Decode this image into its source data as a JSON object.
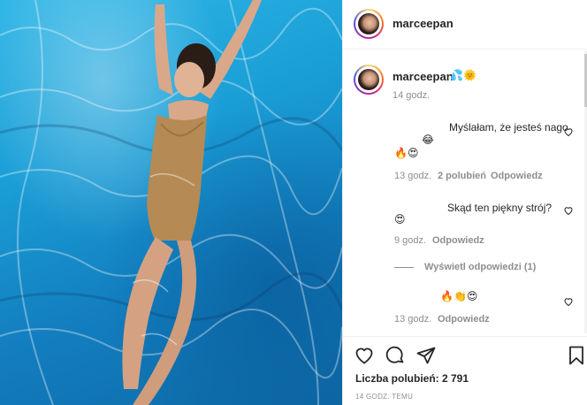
{
  "header": {
    "username": "marceepan"
  },
  "caption": {
    "username": "marceepan",
    "emojis": "💦🌞",
    "time": "14 godz."
  },
  "comments": [
    {
      "text": "Myślałam, że jesteś nago",
      "emoji_inline": "😂",
      "emoji_line": "🔥😍",
      "time": "13 godz.",
      "likes": "2 polubień",
      "reply": "Odpowiedz"
    },
    {
      "text": "Skąd ten piękny strój?",
      "emoji_line": "😍",
      "time": "9 godz.",
      "reply": "Odpowiedz",
      "view_replies": "Wyświetl odpowiedzi (1)"
    },
    {
      "emoji_line": "🔥👏😍",
      "time": "13 godz.",
      "reply": "Odpowiedz"
    }
  ],
  "actions": {
    "like_icon": "heart-icon",
    "comment_icon": "comment-icon",
    "share_icon": "share-icon",
    "save_icon": "bookmark-icon",
    "likes_text": "Liczba polubień: 2 791",
    "timestamp": "14 GODZ. TEMU"
  },
  "colors": {
    "accent_text": "#262626",
    "muted": "#8e8e8e",
    "border": "#efefef",
    "water": "#1a9ed6"
  }
}
